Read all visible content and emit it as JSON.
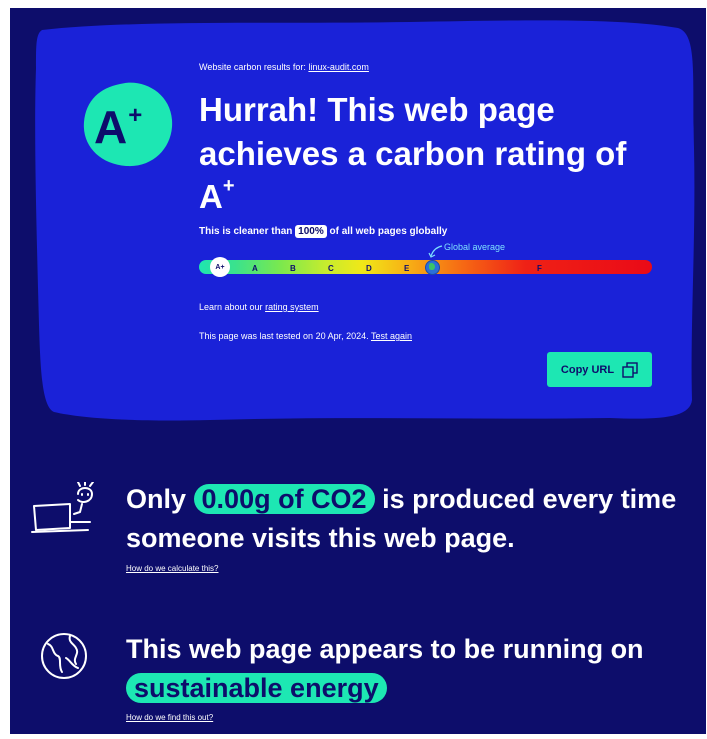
{
  "header": {
    "results_prefix": "Website carbon results for:",
    "site": "linux-audit.com"
  },
  "grade": {
    "letter": "A",
    "plus": "+"
  },
  "headline": {
    "text": "Hurrah! This web page achieves a carbon rating of",
    "grade": "A",
    "plus": "+"
  },
  "cleaner": {
    "prefix": "This is cleaner than",
    "percent": "100%",
    "suffix": "of all web pages globally"
  },
  "scale": {
    "current": "A+",
    "labels": [
      "A",
      "B",
      "C",
      "D",
      "E",
      "F"
    ],
    "global_average_label": "Global average",
    "colors": {
      "start": "#1fe6b0",
      "end": "#ea0a17"
    }
  },
  "learn": {
    "prefix": "Learn about our",
    "link": "rating system"
  },
  "tested": {
    "prefix": "This page was last tested on 20 Apr, 2024.",
    "link": "Test again"
  },
  "copy_button": {
    "label": "Copy URL"
  },
  "co2": {
    "prefix": "Only",
    "amount": "0.00g of CO2",
    "suffix": "is produced every time someone visits this web page.",
    "link": "How do we calculate this?"
  },
  "energy": {
    "prefix": "This web page appears to be running on",
    "highlight": "sustainable energy",
    "link": "How do we find this out?"
  },
  "icons": {
    "laptop": "person-laptop-icon",
    "earth": "earth-icon",
    "copy": "copy-icon",
    "globe": "globe-icon"
  },
  "colors": {
    "background": "#0d0d6b",
    "card": "#1a22d8",
    "accent": "#1de7b3",
    "text": "#ffffff"
  }
}
